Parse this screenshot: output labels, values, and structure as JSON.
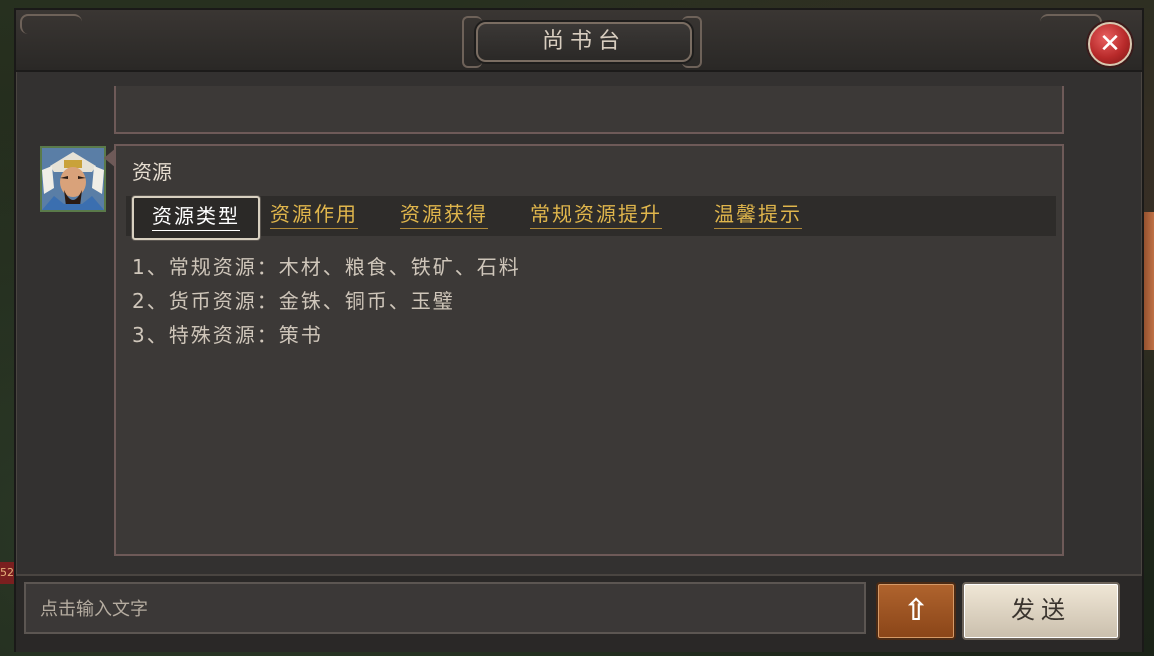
{
  "window": {
    "title": "尚书台"
  },
  "main": {
    "heading": "资源",
    "tabs": [
      {
        "label": "资源类型",
        "active": true
      },
      {
        "label": "资源作用",
        "active": false
      },
      {
        "label": "资源获得",
        "active": false
      },
      {
        "label": "常规资源提升",
        "active": false
      },
      {
        "label": "温馨提示",
        "active": false
      }
    ],
    "lines": [
      "1、常规资源：木材、粮食、铁矿、石料",
      "2、货币资源：金铢、铜币、玉璧",
      "3、特殊资源：策书"
    ]
  },
  "chat": {
    "placeholder": "点击输入文字",
    "send_label": "发送"
  },
  "icons": {
    "close": "close-icon",
    "up": "arrow-up-icon",
    "avatar": "general-portrait"
  },
  "colors": {
    "tab_text": "#e0b64c",
    "active_tab_border": "#d8d0c0",
    "close_button": "#b82a2a",
    "up_button": "#a0562a"
  },
  "background": {
    "badge_text": "52"
  }
}
